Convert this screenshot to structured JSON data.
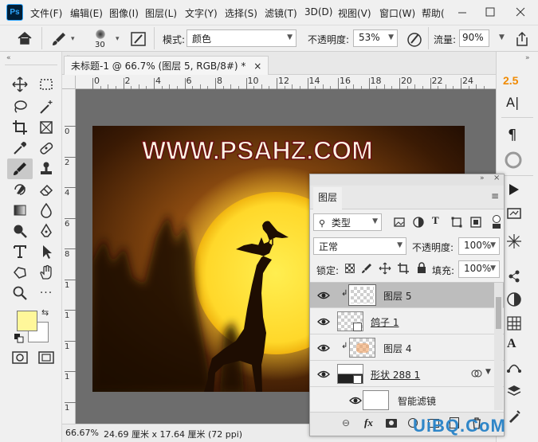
{
  "menu": {
    "logo": "Ps",
    "items": [
      "文件(F)",
      "编辑(E)",
      "图像(I)",
      "图层(L)",
      "文字(Y)",
      "选择(S)",
      "滤镜(T)",
      "3D(D)",
      "视图(V)",
      "窗口(W)",
      "帮助("
    ]
  },
  "options": {
    "brush_size": "30",
    "mode_label": "模式:",
    "mode_value": "颜色",
    "opacity_label": "不透明度:",
    "opacity_value": "53%",
    "flow_label": "流量:",
    "flow_value": "90%"
  },
  "document": {
    "tab_title": "未标题-1 @ 66.7% (图层 5, RGB/8#) *",
    "close": "×",
    "ruler_top": [
      "0",
      "2",
      "4",
      "6",
      "8",
      "10",
      "12",
      "14",
      "16",
      "18",
      "20",
      "22",
      "24"
    ],
    "ruler_left": [
      "0",
      "2",
      "4",
      "6",
      "8",
      "1",
      "1",
      "1",
      "1",
      "1",
      "2"
    ],
    "image_text": "WWW.PSAHZ.COM",
    "zoom": "66.67%",
    "doc_size": "24.69 厘米 x 17.64 厘米 (72 ppi)"
  },
  "right_strip": {
    "value": "2.5"
  },
  "layers_panel": {
    "tab": "图层",
    "filter_value": "类型",
    "blend_mode": "正常",
    "opacity_label": "不透明度:",
    "opacity_value": "100%",
    "lock_label": "锁定:",
    "fill_label": "填充:",
    "fill_value": "100%",
    "layers": [
      {
        "name": "图层 5"
      },
      {
        "name": "鸽子 1"
      },
      {
        "name": "图层 4"
      },
      {
        "name": "形状 288 1"
      },
      {
        "name": "智能滤镜"
      }
    ]
  },
  "watermark": "UiBQ.CoM",
  "colors": {
    "foreground": "#fff79a",
    "background": "#ffffff",
    "accent": "#f08a00"
  }
}
